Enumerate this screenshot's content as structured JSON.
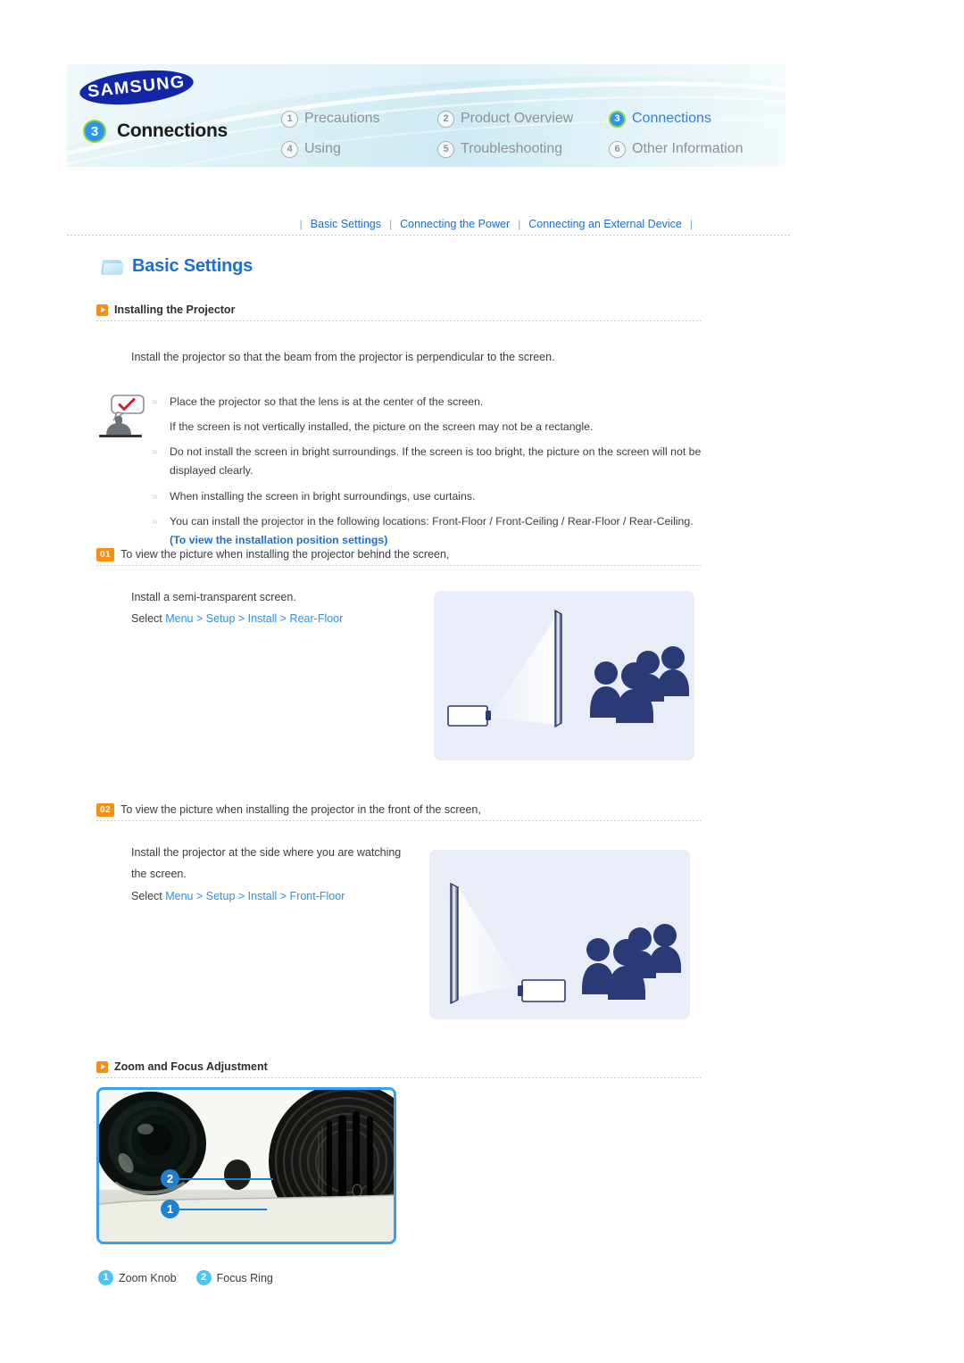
{
  "header": {
    "brand": "SAMSUNG",
    "chapter_number": "3",
    "chapter_label": "Connections",
    "nav": [
      {
        "num": "1",
        "label": "Precautions",
        "active": false
      },
      {
        "num": "2",
        "label": "Product Overview",
        "active": false
      },
      {
        "num": "3",
        "label": "Connections",
        "active": true
      },
      {
        "num": "4",
        "label": "Using",
        "active": false
      },
      {
        "num": "5",
        "label": "Troubleshooting",
        "active": false
      },
      {
        "num": "6",
        "label": "Other Information",
        "active": false
      }
    ]
  },
  "subnav": {
    "items": [
      "Basic Settings",
      "Connecting the Power",
      "Connecting an External Device"
    ],
    "separator": "|"
  },
  "page": {
    "title": "Basic Settings",
    "folder_icon": "folder-icon"
  },
  "section_installing": {
    "heading": "Installing the Projector",
    "intro": "Install the projector so that the beam from the projector is perpendicular to the screen.",
    "notes": [
      {
        "bullet": true,
        "text": "Place the projector so that the lens is at the center of the screen."
      },
      {
        "bullet": false,
        "text": "If the screen is not vertically installed, the picture on the screen may not be a rectangle."
      },
      {
        "bullet": true,
        "text": "Do not install the screen in bright surroundings. If the screen is too bright, the picture on the screen will not be displayed clearly."
      },
      {
        "bullet": true,
        "text": "When installing the screen in bright surroundings, use curtains."
      },
      {
        "bullet": true,
        "text": "You can install the projector in the following locations: Front-Floor / Front-Ceiling / Rear-Floor / Rear-Ceiling.",
        "link": "(To view the installation position settings)"
      }
    ]
  },
  "step_01": {
    "badge": "01",
    "heading": "To view the picture when installing the projector behind the screen,",
    "line1": "Install a semi-transparent screen.",
    "select_prefix": "Select",
    "menu_path": "Menu > Setup > Install > Rear-Floor",
    "illustration": "rear-projection-diagram"
  },
  "step_02": {
    "badge": "02",
    "heading": "To view the picture when installing the projector in the front of the screen,",
    "line1": "Install the projector at the side where you are watching",
    "line2": "the screen.",
    "select_prefix": "Select",
    "menu_path": "Menu > Setup > Install > Front-Floor",
    "illustration": "front-projection-diagram"
  },
  "section_zoom_focus": {
    "heading": "Zoom and Focus Adjustment",
    "callouts": [
      {
        "num": "2",
        "target": "focus-ring"
      },
      {
        "num": "1",
        "target": "zoom-knob"
      }
    ],
    "legend": [
      {
        "num": "1",
        "label": "Zoom Knob"
      },
      {
        "num": "2",
        "label": "Focus Ring"
      }
    ]
  },
  "colors": {
    "accent_blue": "#1a6fd4",
    "link_blue": "#2f8fe8",
    "badge_orange": "#f59112",
    "rule_green": "#b7de6d",
    "nav_active_ring": "#8fd43a",
    "callout_blue": "#1f7fd0",
    "legend_cyan": "#4fc3f2",
    "illus_bg": "#e8edf8",
    "figure_navy": "#2a3a77"
  }
}
